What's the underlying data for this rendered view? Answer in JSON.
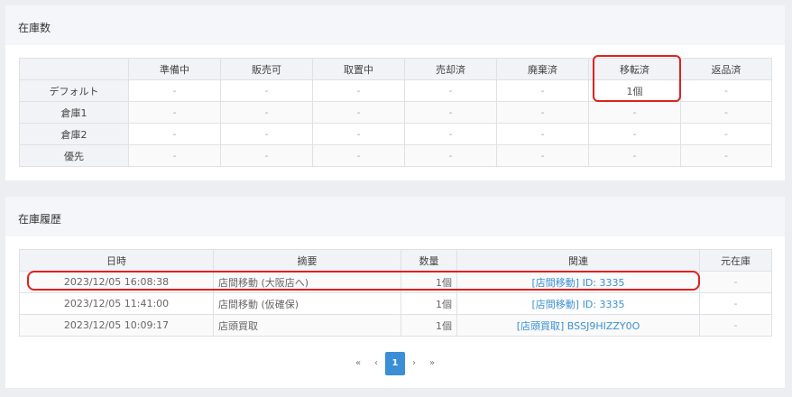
{
  "stock": {
    "title": "在庫数",
    "columns": [
      "",
      "準備中",
      "販売可",
      "取置中",
      "売却済",
      "廃棄済",
      "移転済",
      "返品済"
    ],
    "rows": [
      {
        "label": "デフォルト",
        "cells": [
          "-",
          "-",
          "-",
          "-",
          "-",
          "1個",
          "-"
        ]
      },
      {
        "label": "倉庫1",
        "cells": [
          "-",
          "-",
          "-",
          "-",
          "-",
          "-",
          "-"
        ]
      },
      {
        "label": "倉庫2",
        "cells": [
          "-",
          "-",
          "-",
          "-",
          "-",
          "-",
          "-"
        ]
      },
      {
        "label": "優先",
        "cells": [
          "-",
          "-",
          "-",
          "-",
          "-",
          "-",
          "-"
        ]
      }
    ]
  },
  "history": {
    "title": "在庫履歴",
    "columns": [
      "日時",
      "摘要",
      "数量",
      "関連",
      "元在庫"
    ],
    "rows": [
      {
        "date": "2023/12/05 16:08:38",
        "summary": "店間移動 (大阪店へ)",
        "qty": "1個",
        "related": "[店間移動] ID: 3335",
        "orig": "-"
      },
      {
        "date": "2023/12/05 11:41:00",
        "summary": "店間移動 (仮確保)",
        "qty": "1個",
        "related": "[店間移動] ID: 3335",
        "orig": "-"
      },
      {
        "date": "2023/12/05 10:09:17",
        "summary": "店頭買取",
        "qty": "1個",
        "related": "[店頭買取] BSSJ9HIZZY0O",
        "orig": "-"
      }
    ]
  },
  "pager": {
    "first": "«",
    "prev": "‹",
    "current": "1",
    "next": "›",
    "last": "»"
  },
  "colors": {
    "accent": "#3a8fd6",
    "highlight": "#e02020"
  }
}
